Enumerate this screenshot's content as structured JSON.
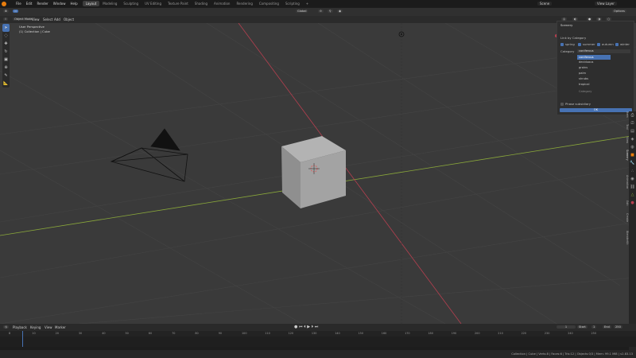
{
  "topbar": {
    "menus": [
      "File",
      "Edit",
      "Render",
      "Window",
      "Help"
    ],
    "workspaces": [
      "Layout",
      "Modeling",
      "Sculpting",
      "UV Editing",
      "Texture Paint",
      "Shading",
      "Animation",
      "Rendering",
      "Compositing",
      "Scripting"
    ],
    "active_workspace": "Layout",
    "scene": "Scene",
    "view_layer": "View Layer"
  },
  "viewport_header": {
    "mode": "Object Mode",
    "menus": [
      "View",
      "Select",
      "Add",
      "Object"
    ],
    "snap": "Global",
    "persp": "User Perspective",
    "collection": "(1) Collection | Cube",
    "options": "Options"
  },
  "panel": {
    "title": "Scenery",
    "link_label": "Link by Category",
    "seasons": [
      "spring",
      "summer",
      "autumn",
      "winter"
    ],
    "category_label": "Category",
    "category_value": "coniferous",
    "list": [
      "coniferous",
      "deciduous",
      "grains",
      "palm",
      "shrubs",
      "tropical"
    ],
    "list_footer": "Category",
    "phase_label": "Phase subsidiary",
    "ok_label": "OK"
  },
  "sidebar_tabs": [
    "Item",
    "Tool",
    "View",
    "Scenery",
    "Animation",
    "Edit",
    "Create",
    "BlenderKit"
  ],
  "timeline": {
    "menus": [
      "Playback",
      "Keying",
      "View",
      "Marker"
    ],
    "current_frame": "1",
    "start": "1",
    "end": "250",
    "start_label": "Start",
    "end_label": "End",
    "ticks": [
      "0",
      "10",
      "20",
      "30",
      "40",
      "50",
      "60",
      "70",
      "80",
      "90",
      "100",
      "110",
      "120",
      "130",
      "140",
      "150",
      "160",
      "170",
      "180",
      "190",
      "200",
      "210",
      "220",
      "230",
      "240",
      "250"
    ]
  },
  "status": {
    "text": "Collection | Cube | Verts:8 | Faces:6 | Tris:12 | Objects:0/3 | Mem: 99.1 MiB | v2.83.13"
  },
  "colors": {
    "accent": "#4772b3",
    "grid_bg": "#3d3d3d",
    "x_axis": "#b53f4f",
    "y_axis": "#8aa83a"
  }
}
